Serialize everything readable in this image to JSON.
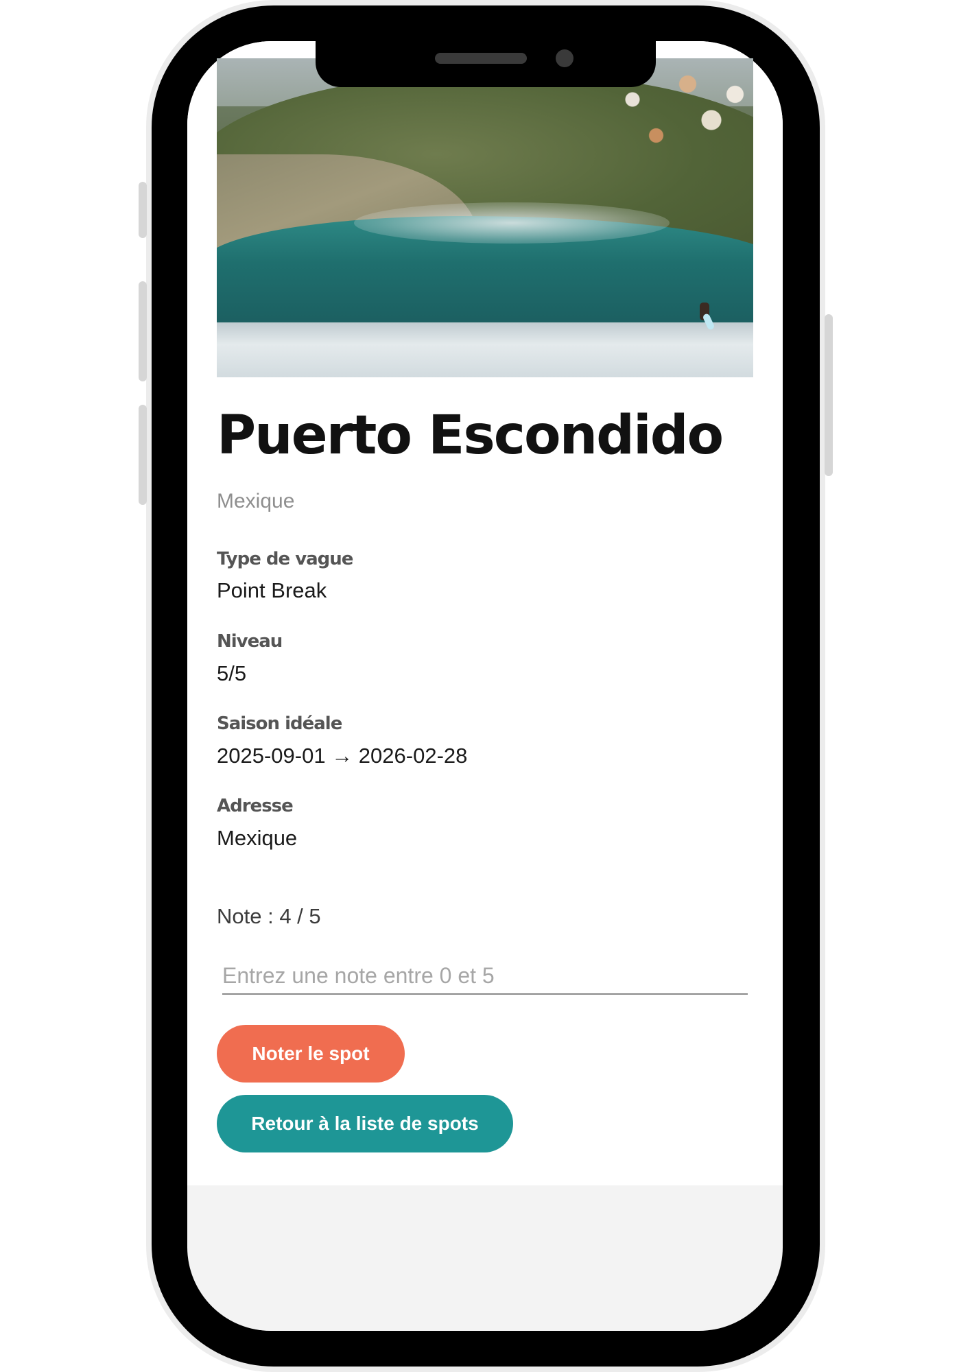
{
  "spot": {
    "name": "Puerto Escondido",
    "country": "Mexique",
    "image_alt": "Surfer riding a large wave at Puerto Escondido"
  },
  "details": [
    {
      "label": "Type de vague",
      "value": "Point Break"
    },
    {
      "label": "Niveau",
      "value": "5/5"
    },
    {
      "label": "Saison idéale",
      "value": "2025-09-01 → 2026-02-28"
    },
    {
      "label": "Adresse",
      "value": "Mexique"
    }
  ],
  "rating": {
    "current_text": "Note : 4 / 5",
    "input_value": "",
    "input_placeholder": "Entrez une note entre 0 et 5"
  },
  "actions": {
    "rate_label": "Noter le spot",
    "back_label": "Retour à la liste de spots"
  },
  "colors": {
    "rate_button": "#f06d50",
    "back_button": "#1e9696",
    "muted_text": "#8e8e8e"
  }
}
